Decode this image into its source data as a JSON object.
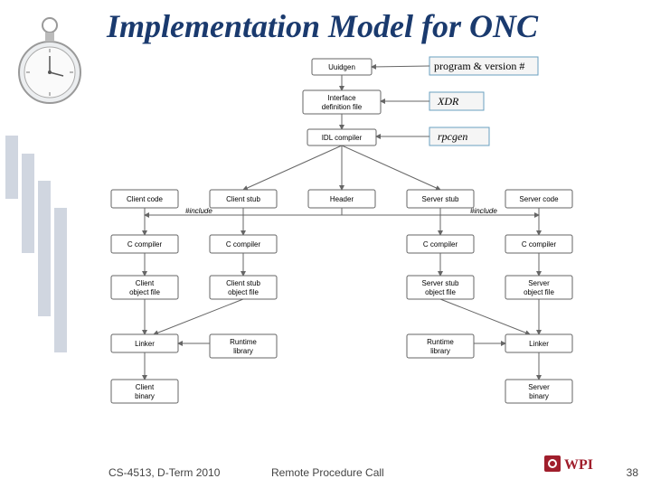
{
  "title": "Implementation Model for ONC",
  "callouts": {
    "c1": "program & version #",
    "c2": "XDR",
    "c3": "rpcgen"
  },
  "boxes": {
    "uuidgen": "Uuidgen",
    "idf": "Interface\ndefinition file",
    "idl": "IDL compiler",
    "clientcode": "Client code",
    "clientstub": "Client stub",
    "header": "Header",
    "serverstub": "Server stub",
    "servercode": "Server code",
    "cc1": "C compiler",
    "cc2": "C compiler",
    "cc3": "C compiler",
    "cc4": "C compiler",
    "cof": "Client\nobject file",
    "csof": "Client stub\nobject file",
    "ssof": "Server stub\nobject file",
    "sof": "Server\nobject file",
    "linker1": "Linker",
    "rtl1": "Runtime\nlibrary",
    "rtl2": "Runtime\nlibrary",
    "linker2": "Linker",
    "cbin": "Client\nbinary",
    "sbin": "Server\nbinary"
  },
  "labels": {
    "include1": "#include",
    "include2": "#include"
  },
  "footer": {
    "left": "CS-4513, D-Term 2010",
    "center": "Remote Procedure Call",
    "page": "38",
    "logo": "WPI"
  }
}
